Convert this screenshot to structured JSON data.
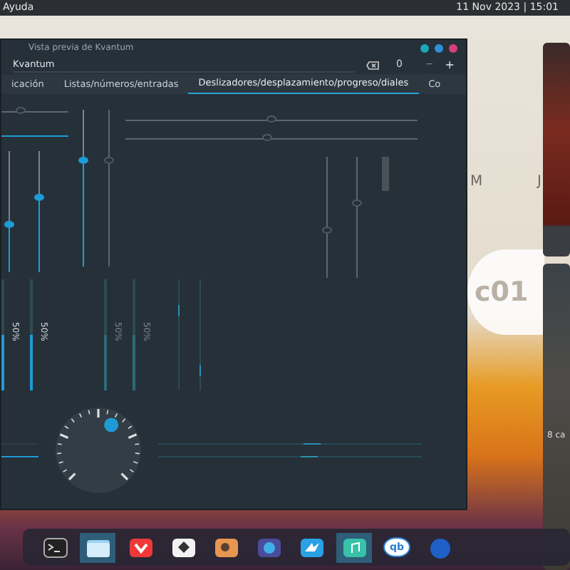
{
  "top_bar": {
    "menu": "Ayuda",
    "clock": "11 Nov 2023 | 15:01"
  },
  "window": {
    "title": "Vista previa de Kvantum",
    "title_buttons": [
      {
        "color": "#1aa7b8"
      },
      {
        "color": "#2f8fd8"
      },
      {
        "color": "#d6407a"
      }
    ]
  },
  "toolbar": {
    "field_value": "Kvantum",
    "spin_value": "0",
    "minus": "−",
    "plus": "+"
  },
  "tabs": [
    {
      "label": "icación",
      "selected": false
    },
    {
      "label": "Listas/números/entradas",
      "selected": false
    },
    {
      "label": "Deslizadores/desplazamiento/progreso/diales",
      "selected": true
    },
    {
      "label": "Co",
      "selected": false
    }
  ],
  "left_hsliders": [
    {
      "level": 0.3,
      "active": false
    },
    {
      "level": 1,
      "active": true
    }
  ],
  "vsliders_left": [
    {
      "level": 0.4,
      "active": true
    },
    {
      "level": 0.62,
      "active": true
    },
    {
      "level": 0.68,
      "active": true
    },
    {
      "level": 0.68,
      "active": false
    }
  ],
  "hsliders": [
    {
      "level": 0.5,
      "active": false
    },
    {
      "level": 0.49,
      "active": false
    }
  ],
  "vsliders_right": [
    {
      "level": 0.4,
      "active": false
    },
    {
      "level": 0.62,
      "active": false
    }
  ],
  "progress_bars": [
    {
      "level": 0.5,
      "label": "50%",
      "enabled": true
    },
    {
      "level": 0.5,
      "label": "50%",
      "enabled": true
    },
    {
      "level": 0.5,
      "label": "50%",
      "enabled": false
    },
    {
      "level": 0.5,
      "label": "50%",
      "enabled": false
    }
  ],
  "busy_bars": [
    {
      "level": 0.75
    },
    {
      "level": 0.15
    }
  ],
  "left_progress": {
    "level": 1
  },
  "dial": {
    "level": 0.6
  },
  "busy_lines": [
    {
      "level": 0.55
    },
    {
      "level": 0.54
    }
  ],
  "desktop": {
    "letters": [
      "M",
      "J"
    ],
    "badge_text": "c01",
    "window_text": "8 ca"
  },
  "dock": [
    {
      "kind": "terminal",
      "active": false
    },
    {
      "kind": "folder",
      "active": true
    },
    {
      "kind": "chevron",
      "active": false
    },
    {
      "kind": "white",
      "active": false
    },
    {
      "kind": "orange",
      "active": false
    },
    {
      "kind": "purple",
      "active": false
    },
    {
      "kind": "bird",
      "active": false
    },
    {
      "kind": "music",
      "active": true
    },
    {
      "kind": "qb",
      "active": false,
      "label": "qb"
    },
    {
      "kind": "globe",
      "active": false
    }
  ]
}
